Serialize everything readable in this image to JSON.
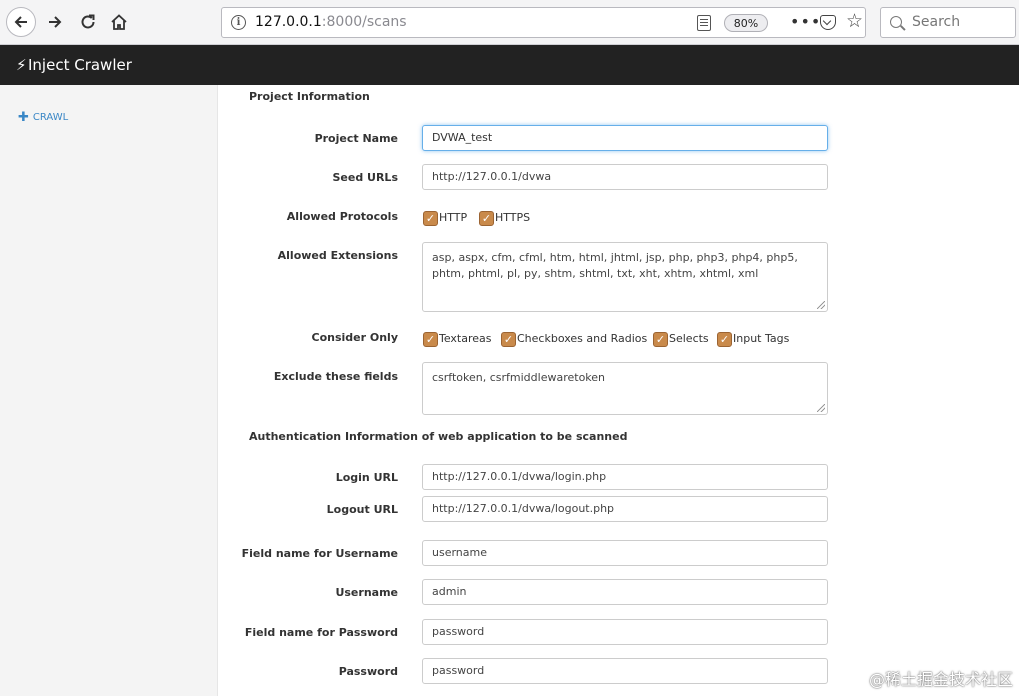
{
  "browser": {
    "url_host": "127.0.0.1",
    "url_port_path": ":8000/scans",
    "zoom": "80%",
    "search_placeholder": "Search"
  },
  "app": {
    "brand": "Inject Crawler"
  },
  "sidebar": {
    "crawl_label": "CRAWL"
  },
  "form": {
    "project_section": "Project Information",
    "project_name_label": "Project Name",
    "project_name_value": "DVWA_test",
    "seed_urls_label": "Seed URLs",
    "seed_urls_value": "http://127.0.0.1/dvwa",
    "allowed_protocols_label": "Allowed Protocols",
    "protocols": [
      "HTTP",
      "HTTPS"
    ],
    "allowed_extensions_label": "Allowed Extensions",
    "allowed_extensions_value": "asp, aspx, cfm, cfml, htm, html, jhtml, jsp, php, php3, php4, php5, phtm, phtml, pl, py, shtm, shtml, txt, xht, xhtm, xhtml, xml",
    "consider_only_label": "Consider Only",
    "consider_only": [
      "Textareas",
      "Checkboxes and Radios",
      "Selects",
      "Input Tags"
    ],
    "exclude_fields_label": "Exclude these fields",
    "exclude_fields_value": "csrftoken, csrfmiddlewaretoken",
    "auth_section": "Authentication Information of web application to be scanned",
    "login_url_label": "Login URL",
    "login_url_value": "http://127.0.0.1/dvwa/login.php",
    "logout_url_label": "Logout URL",
    "logout_url_value": "http://127.0.0.1/dvwa/logout.php",
    "username_field_label": "Field name for Username",
    "username_field_value": "username",
    "username_label": "Username",
    "username_value": "admin",
    "password_field_label": "Field name for Password",
    "password_field_value": "password",
    "password_label": "Password",
    "password_value": "password"
  },
  "watermark": "@稀土掘金技术社区"
}
